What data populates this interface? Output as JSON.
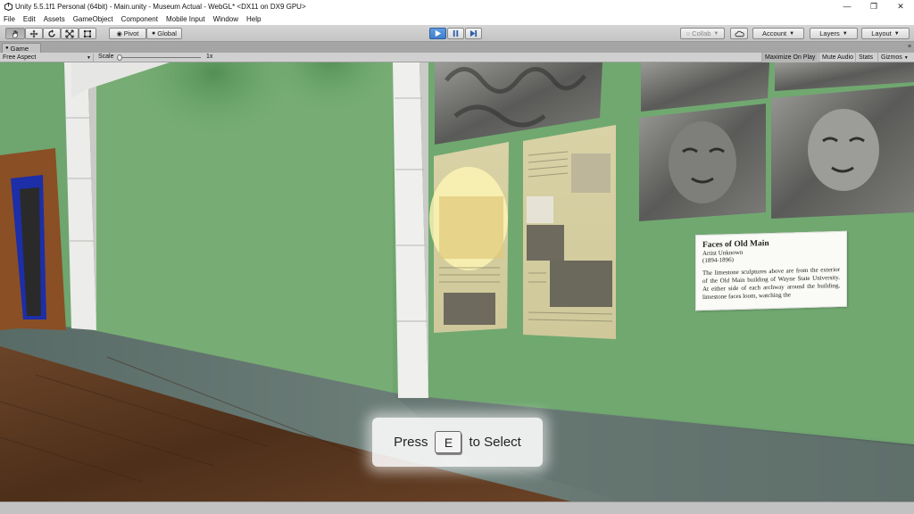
{
  "window": {
    "title": "Unity 5.5.1f1 Personal (64bit) - Main.unity - Museum Actual - WebGL* <DX11 on DX9 GPU>",
    "minimize_icon": "minimize-glyph",
    "maximize_icon": "restore-glyph",
    "close_icon": "close-glyph"
  },
  "menu": [
    "File",
    "Edit",
    "Assets",
    "GameObject",
    "Component",
    "Mobile Input",
    "Window",
    "Help"
  ],
  "toolbar": {
    "pivot_label": "Pivot",
    "global_label": "Global",
    "collab_label": "Collab",
    "account_label": "Account",
    "layers_label": "Layers",
    "layout_label": "Layout",
    "play_accent": "#3f7fcc"
  },
  "game_view": {
    "tab_label": "Game",
    "aspect_label": "Free Aspect",
    "scale_label": "Scale",
    "scale_value": "1x",
    "maximize_label": "Maximize On Play",
    "mute_label": "Mute Audio",
    "stats_label": "Stats",
    "gizmos_label": "Gizmos"
  },
  "exhibit": {
    "title": "Faces of Old Main",
    "artist": "Artist Unknown",
    "years": "(1894-1896)",
    "description": "The limestone sculptures above are from the exterior of the Old Main building of Wayne State University. At either side of each archway around the building, limestone faces loom, watching the"
  },
  "prompt": {
    "before": "Press",
    "key": "E",
    "after": "to Select"
  },
  "colors": {
    "wall": "#6fa56f",
    "floor": "#5a3a22",
    "marble": "#5d6f6a"
  }
}
